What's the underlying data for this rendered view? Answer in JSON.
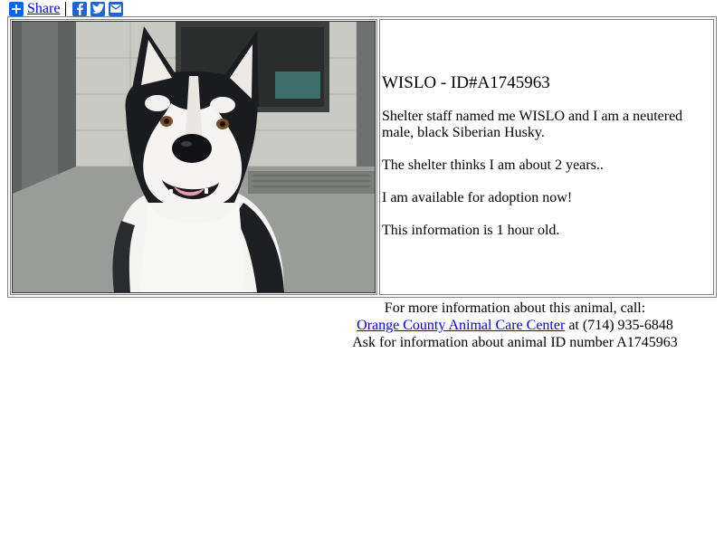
{
  "share_bar": {
    "share_label": "Share",
    "icons": [
      "plus-icon",
      "facebook-icon",
      "twitter-icon",
      "email-icon"
    ]
  },
  "animal": {
    "title": "WISLO - ID#A1745963",
    "line1": "Shelter staff named me WISLO and I am a neutered male, black Siberian Husky.",
    "line2": "The shelter thinks I am about 2 years..",
    "line3": "I am available for adoption now!",
    "line4": "This information is 1 hour old."
  },
  "contact": {
    "intro": "For more information about this animal, call:",
    "shelter_name": "Orange County Animal Care Center",
    "phone_text": " at (714) 935-6848",
    "ask_text": "Ask for information about animal ID number A1745963"
  },
  "colors": {
    "link": "#0000ee",
    "share_blue": "#0166ff"
  }
}
